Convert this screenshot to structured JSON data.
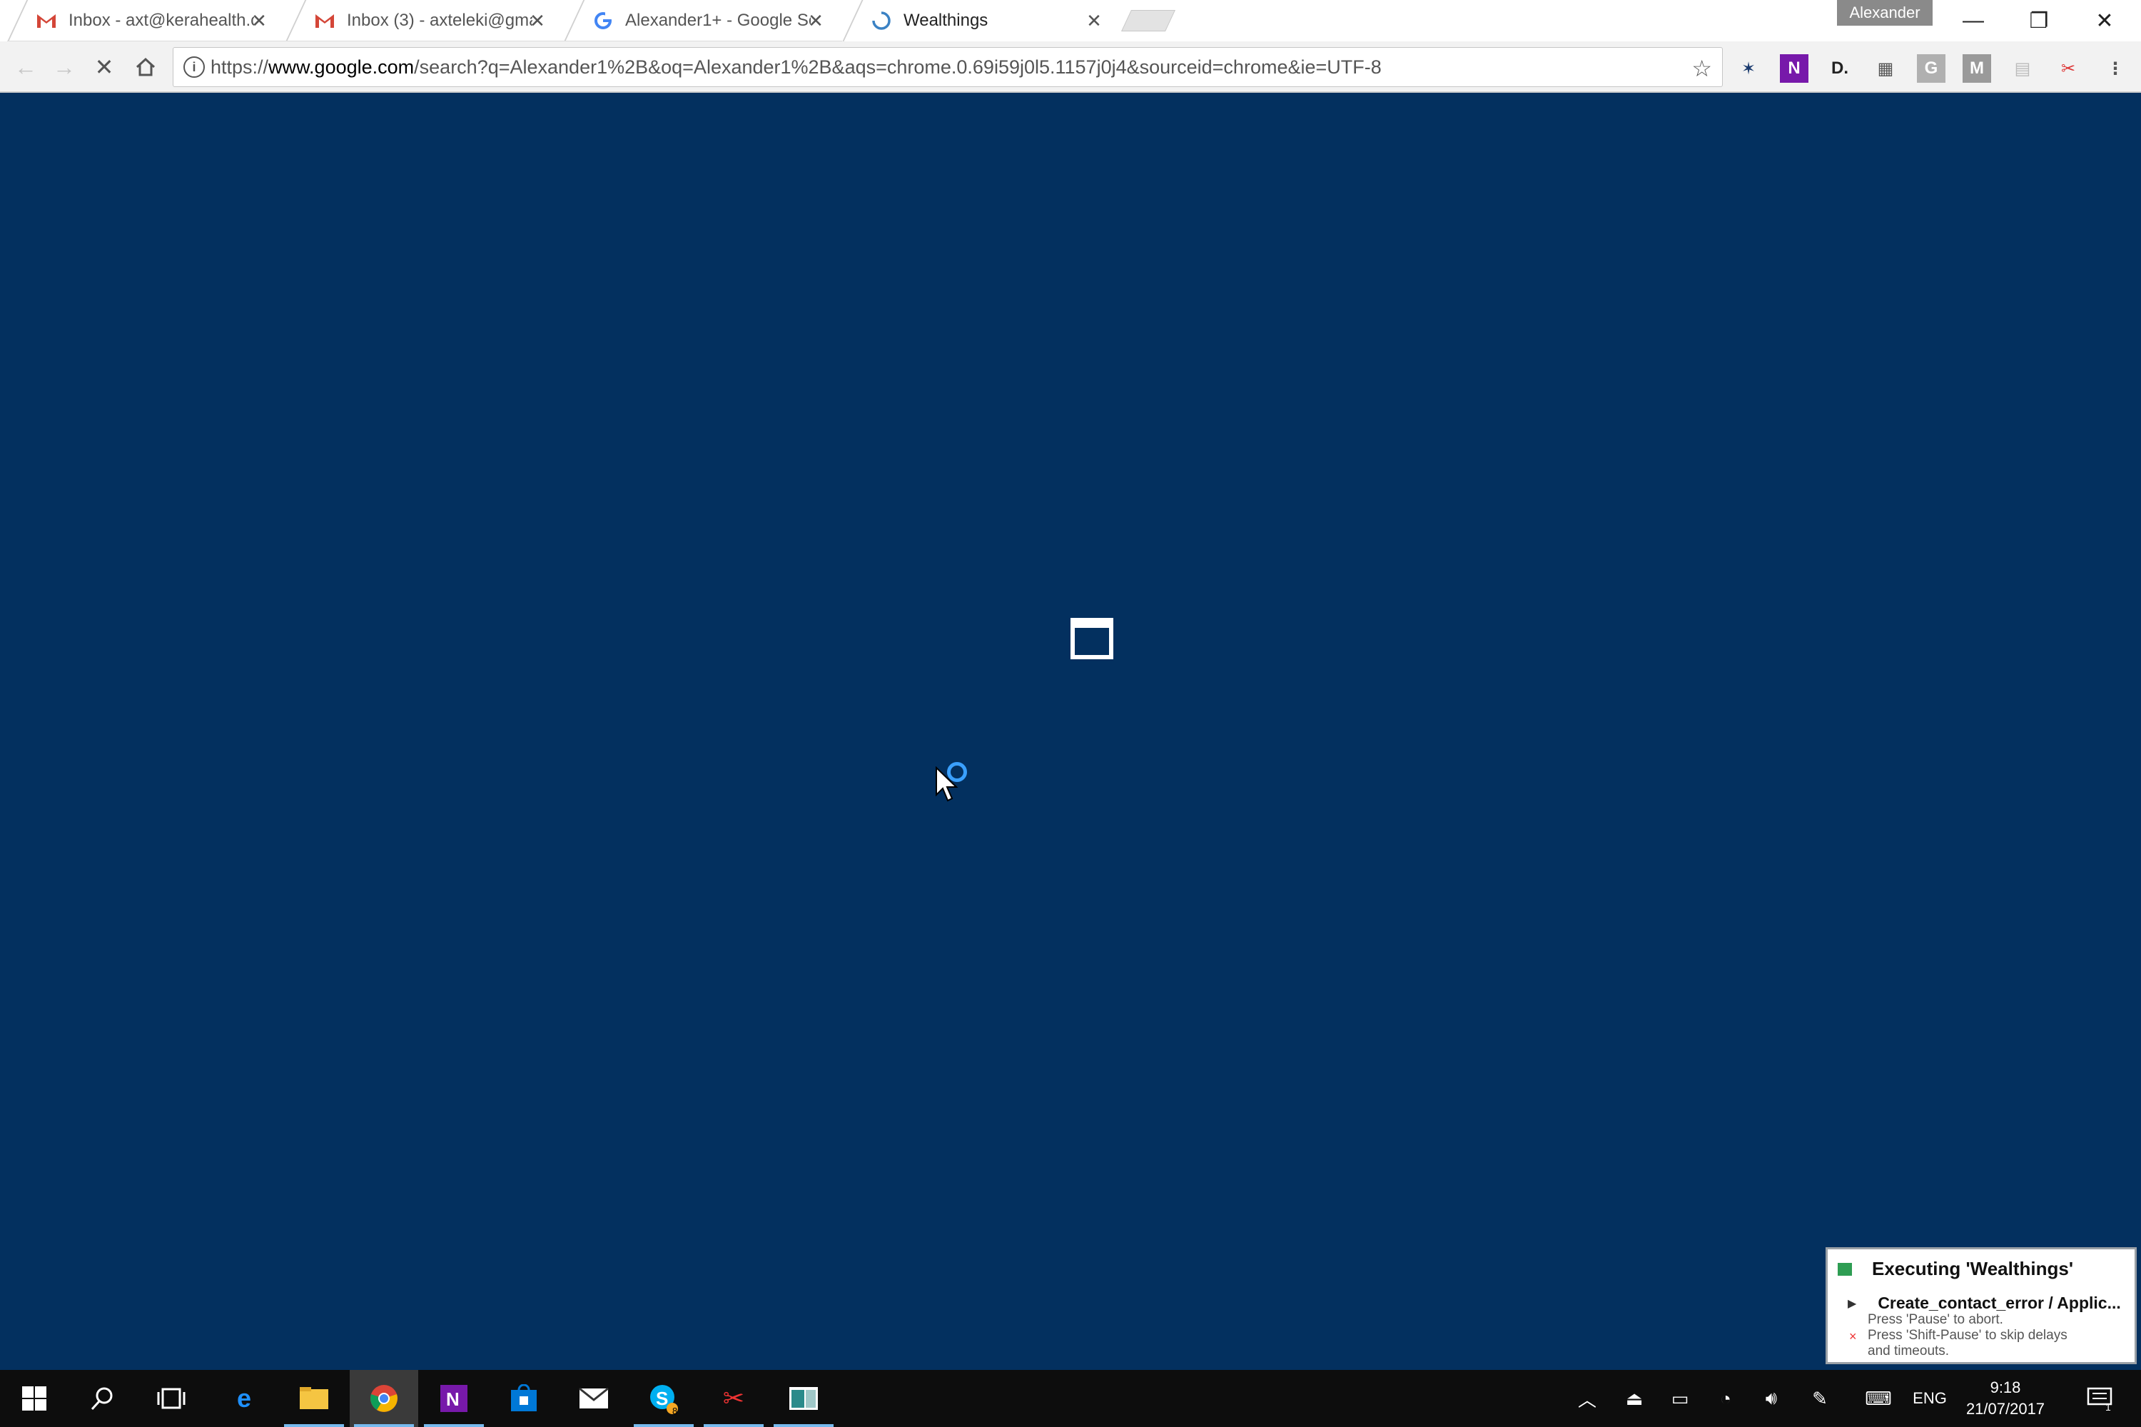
{
  "browser": {
    "tabs": [
      {
        "title": "Inbox - axt@kerahealth.c",
        "icon": "gmail-icon"
      },
      {
        "title": "Inbox (3) - axteleki@gma",
        "icon": "gmail-icon"
      },
      {
        "title": "Alexander1+ - Google Se",
        "icon": "google-icon"
      },
      {
        "title": "Wealthings",
        "icon": "loading-icon"
      }
    ],
    "profile_name": "Alexander",
    "url_prefix": "https://",
    "url_host": "www.google.com",
    "url_path": "/search?q=Alexander1%2B&oq=Alexander1%2B&aqs=chrome.0.69i59j0l5.1157j0j4&sourceid=chrome&ie=UTF-8",
    "extensions": [
      "grammarly-like-icon",
      "onenote-icon",
      "d-icon",
      "qr-icon",
      "g-icon",
      "m-icon",
      "reader-icon",
      "tools-icon"
    ]
  },
  "notification": {
    "title": "Executing 'Wealthings'",
    "step": "Create_contact_error / Applic...",
    "line1": "Press 'Pause' to abort.",
    "line2": "Press 'Shift-Pause' to skip delays",
    "line3": "and timeouts."
  },
  "taskbar": {
    "language": "ENG",
    "time": "9:18",
    "date": "21/07/2017",
    "skype_badge": "8",
    "notifications_count": "1"
  },
  "colors": {
    "page_background": "#03305f",
    "accent": "#76b9ed"
  }
}
